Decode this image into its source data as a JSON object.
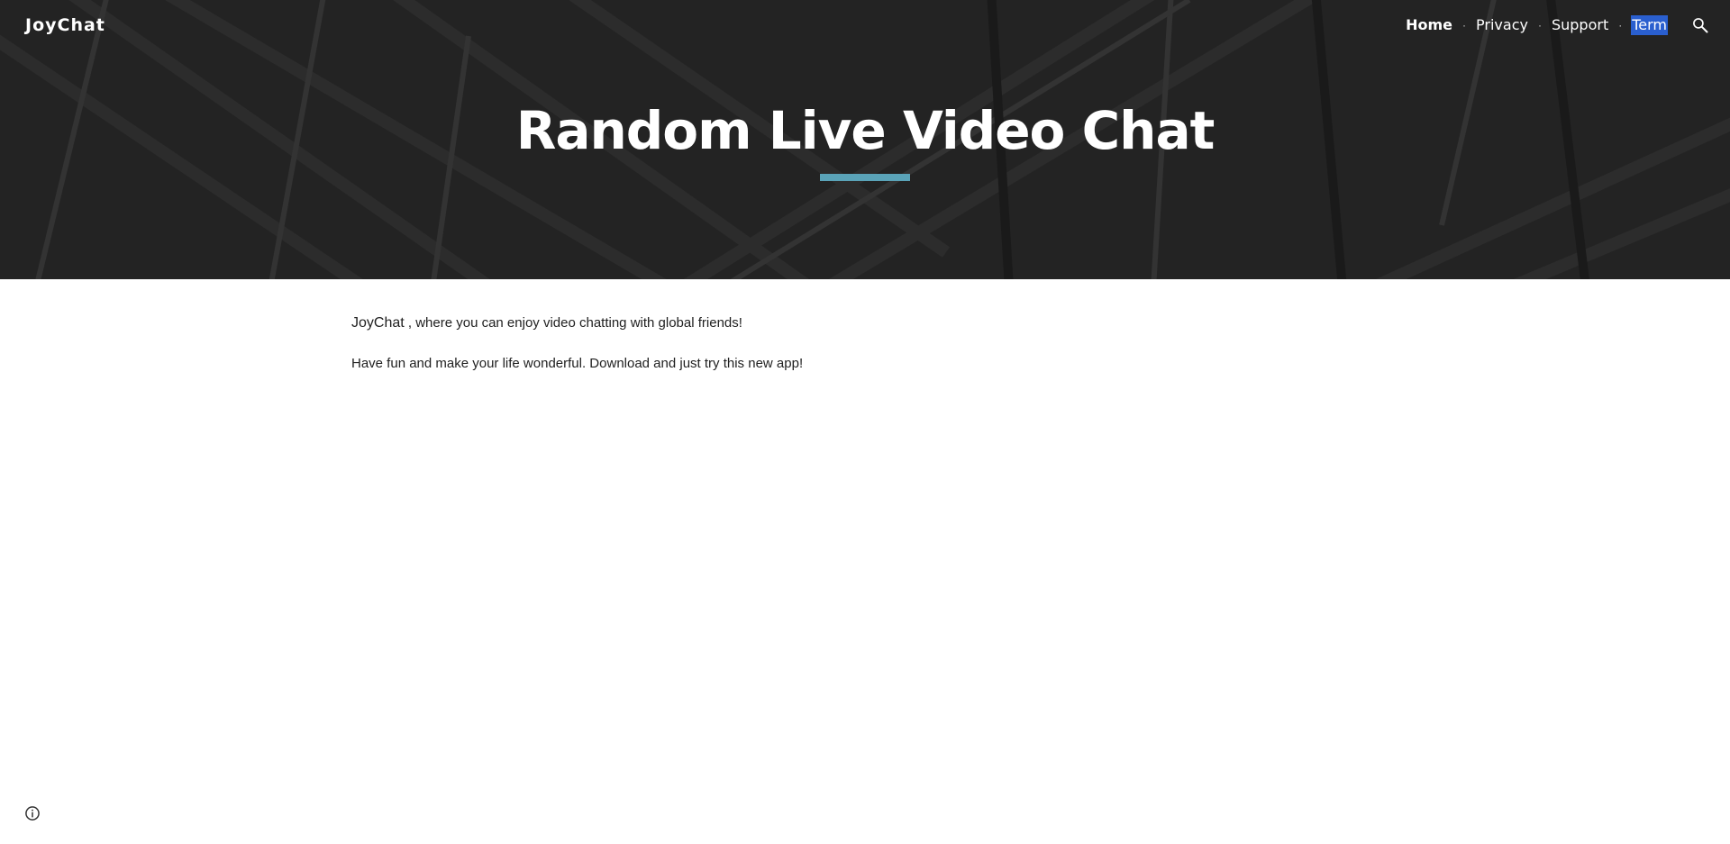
{
  "header": {
    "brand": "JoyChat",
    "nav": [
      {
        "label": "Home"
      },
      {
        "label": "Privacy"
      },
      {
        "label": "Support"
      },
      {
        "label": "Term"
      }
    ],
    "separator": "·",
    "search_icon": "search-icon",
    "title": "Random Live Video Chat",
    "accent_color": "#5aa3b8"
  },
  "main": {
    "paragraph1_brand": "JoyChat",
    "paragraph1_rest": " , where you can enjoy video chatting with global friends!",
    "paragraph2": "Have fun and make your life wonderful. Download and just try this new app!"
  },
  "footer": {
    "info_icon": "info-icon"
  }
}
